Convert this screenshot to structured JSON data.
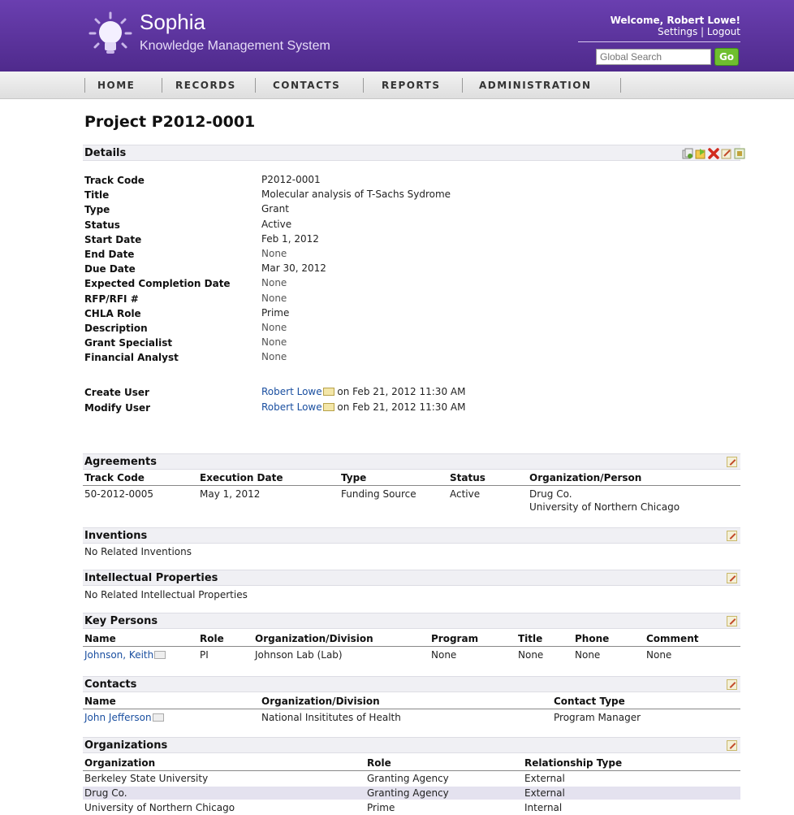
{
  "header": {
    "app_name": "Sophia",
    "app_subtitle": "Knowledge Management System",
    "welcome": "Welcome, Robert Lowe!",
    "settings": "Settings",
    "separator": "|",
    "logout": "Logout",
    "search_placeholder": "Global Search",
    "search_button": "Go",
    "brand_color": "#5a3399"
  },
  "nav": [
    "HOME",
    "RECORDS",
    "CONTACTS",
    "REPORTS",
    "ADMINISTRATION"
  ],
  "page_title": "Project P2012-0001",
  "details": {
    "title": "Details",
    "toolbar_icons": [
      "copy-icon",
      "export-icon",
      "delete-icon",
      "edit-icon",
      "print-icon"
    ],
    "rows": [
      {
        "label": "Track Code",
        "value": "P2012-0001"
      },
      {
        "label": "Title",
        "value": "Molecular analysis of T-Sachs Sydrome"
      },
      {
        "label": "Type",
        "value": "Grant"
      },
      {
        "label": "Status",
        "value": "Active"
      },
      {
        "label": "Start Date",
        "value": "Feb 1, 2012"
      },
      {
        "label": "End Date",
        "value": "None"
      },
      {
        "label": "Due Date",
        "value": "Mar 30, 2012"
      },
      {
        "label": "Expected Completion Date",
        "value": "None"
      },
      {
        "label": "RFP/RFI #",
        "value": "None"
      },
      {
        "label": "CHLA Role",
        "value": "Prime"
      },
      {
        "label": "Description",
        "value": "None"
      },
      {
        "label": "Grant Specialist",
        "value": "None"
      },
      {
        "label": "Financial Analyst",
        "value": "None"
      }
    ],
    "audit": [
      {
        "label": "Create User",
        "user": "Robert Lowe",
        "when": " on Feb 21, 2012 11:30 AM"
      },
      {
        "label": "Modify User",
        "user": "Robert Lowe",
        "when": " on Feb 21, 2012 11:30 AM"
      }
    ]
  },
  "agreements": {
    "title": "Agreements",
    "columns": [
      "Track Code",
      "Execution Date",
      "Type",
      "Status",
      "Organization/Person"
    ],
    "row": {
      "track_code": "50-2012-0005",
      "execution_date": "May 1, 2012",
      "type": "Funding Source",
      "status": "Active",
      "org1": "Drug Co.",
      "org2": "University of Northern Chicago"
    }
  },
  "inventions": {
    "title": "Inventions",
    "empty": "No Related Inventions"
  },
  "ip": {
    "title": "Intellectual Properties",
    "empty": "No Related Intellectual Properties"
  },
  "key_persons": {
    "title": "Key Persons",
    "columns": [
      "Name",
      "Role",
      "Organization/Division",
      "Program",
      "Title",
      "Phone",
      "Comment"
    ],
    "row": {
      "name": "Johnson, Keith",
      "role": "PI",
      "org": "Johnson Lab (Lab)",
      "program": "None",
      "title": "None",
      "phone": "None",
      "comment": "None"
    }
  },
  "contacts": {
    "title": "Contacts",
    "columns": [
      "Name",
      "Organization/Division",
      "Contact Type"
    ],
    "row": {
      "name": "John Jefferson",
      "org": "National Insititutes of Health",
      "type": "Program Manager"
    }
  },
  "organizations": {
    "title": "Organizations",
    "columns": [
      "Organization",
      "Role",
      "Relationship Type"
    ],
    "rows": [
      {
        "org": "Berkeley State University",
        "role": "Granting Agency",
        "rel": "External"
      },
      {
        "org": "Drug Co.",
        "role": "Granting Agency",
        "rel": "External"
      },
      {
        "org": "University of Northern Chicago",
        "role": "Prime",
        "rel": "Internal"
      }
    ]
  }
}
